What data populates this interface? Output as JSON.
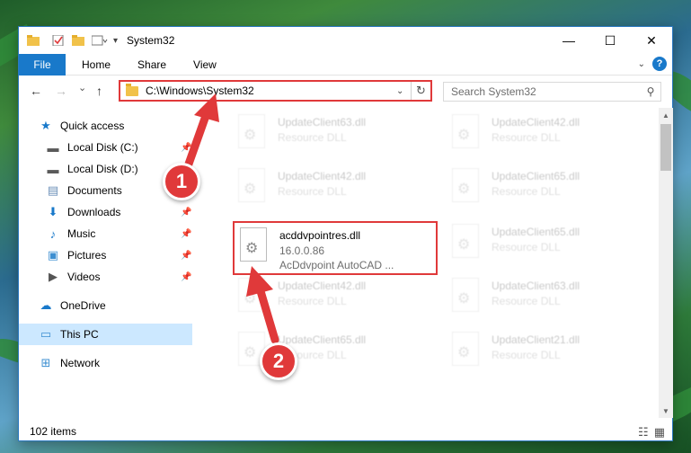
{
  "window": {
    "title": "System32",
    "controls": {
      "minimize": "—",
      "maximize": "☐",
      "close": "✕"
    }
  },
  "ribbon": {
    "tabs": [
      "File",
      "Home",
      "Share",
      "View"
    ],
    "expand_icon": "chevron-down-icon",
    "help": "?"
  },
  "nav": {
    "back": "←",
    "forward": "→",
    "recent": "⌄",
    "up": "↑",
    "address": "C:\\Windows\\System32",
    "address_dropdown": "⌄",
    "refresh": "↻",
    "search_placeholder": "Search System32",
    "search_icon": "⚲"
  },
  "sidebar": {
    "items": [
      {
        "label": "Quick access",
        "icon": "star-icon",
        "pinned": false
      },
      {
        "label": "Local Disk (C:)",
        "icon": "drive-icon",
        "pinned": true
      },
      {
        "label": "Local Disk (D:)",
        "icon": "drive-icon",
        "pinned": true
      },
      {
        "label": "Documents",
        "icon": "documents-icon",
        "pinned": true
      },
      {
        "label": "Downloads",
        "icon": "downloads-icon",
        "pinned": true
      },
      {
        "label": "Music",
        "icon": "music-icon",
        "pinned": true
      },
      {
        "label": "Pictures",
        "icon": "pictures-icon",
        "pinned": true
      },
      {
        "label": "Videos",
        "icon": "videos-icon",
        "pinned": true
      },
      {
        "label": "OneDrive",
        "icon": "cloud-icon",
        "pinned": false
      },
      {
        "label": "This PC",
        "icon": "computer-icon",
        "pinned": false,
        "selected": true
      },
      {
        "label": "Network",
        "icon": "network-icon",
        "pinned": false
      }
    ],
    "pin_glyph": "📌"
  },
  "files": {
    "left_column": [
      {
        "name": "UpdateClient63.dll",
        "type": "Resource DLL"
      },
      {
        "name": "UpdateClient42.dll",
        "type": "Resource DLL"
      },
      {
        "name": "acddvpointres.dll",
        "version": "16.0.0.86",
        "description": "AcDdvpoint AutoCAD ..."
      },
      {
        "name": "UpdateClient42.dll",
        "type": "Resource DLL"
      },
      {
        "name": "UpdateClient65.dll",
        "type": "Resource DLL"
      }
    ],
    "right_column": [
      {
        "name": "UpdateClient42.dll",
        "type": "Resource DLL"
      },
      {
        "name": "UpdateClient65.dll",
        "type": "Resource DLL"
      },
      {
        "name": "UpdateClient65.dll",
        "type": "Resource DLL"
      },
      {
        "name": "UpdateClient63.dll",
        "type": "Resource DLL"
      },
      {
        "name": "UpdateClient21.dll",
        "type": "Resource DLL"
      }
    ]
  },
  "status": {
    "item_count": "102 items"
  },
  "annotations": {
    "step1": "1",
    "step2": "2"
  },
  "colors": {
    "accent": "#1979ca",
    "annotation_red": "#e0393a",
    "selection": "#cce8ff"
  }
}
